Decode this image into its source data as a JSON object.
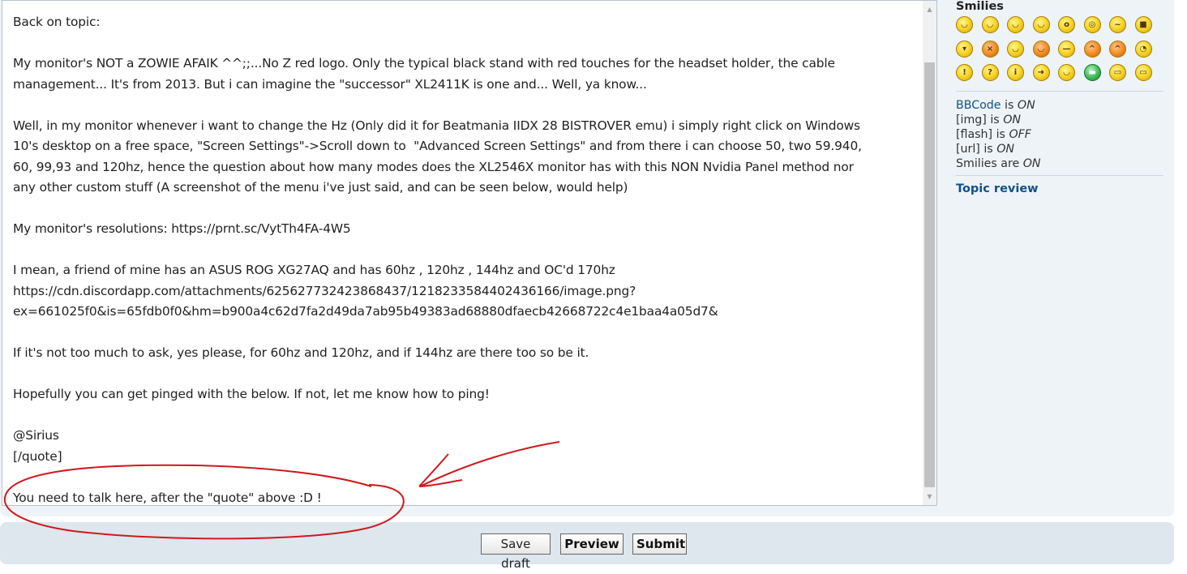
{
  "editor": {
    "lines": [
      "Back on topic:",
      "",
      "My monitor's NOT a ZOWIE AFAIK ^^;;...No Z red logo. Only the typical black stand with red touches for the headset holder, the cable",
      "management... It's from 2013. But i can imagine the \"successor\" XL2411K is one and... Well, ya know...",
      "",
      "Well, in my monitor whenever i want to change the Hz (Only did it for Beatmania IIDX 28 BISTROVER emu) i simply right click on Windows",
      "10's desktop on a free space, \"Screen Settings\"->Scroll down to  \"Advanced Screen Settings\" and from there i can choose 50, two 59.940,",
      "60, 99,93 and 120hz, hence the question about how many modes does the XL2546X monitor has with this NON Nvidia Panel method nor",
      "any other custom stuff (A screenshot of the menu i've just said, and can be seen below, would help)",
      "",
      "My monitor's resolutions: https://prnt.sc/VytTh4FA-4W5",
      "",
      "I mean, a friend of mine has an ASUS ROG XG27AQ and has 60hz , 120hz , 144hz and OC'd 170hz",
      "https://cdn.discordapp.com/attachments/625627732423868437/1218233584402436166/image.png?",
      "ex=661025f0&is=65fdb0f0&hm=b900a4c62d7fa2d49da7ab95b49383ad68880dfaecb42668722c4e1baa4a05d7&",
      "",
      "If it's not too much to ask, yes please, for 60hz and 120hz, and if 144hz are there too so be it.",
      "",
      "Hopefully you can get pinged with the below. If not, let me know how to ping!",
      "",
      "@Sirius",
      "[/quote]",
      "",
      "You need to talk here, after the \"quote\" above :D !"
    ]
  },
  "sidebar": {
    "smilies_title": "Smilies",
    "bbcode_link": "BBCode",
    "bbcode_is": " is ",
    "bbcode_state": "ON",
    "img_label": "[img] is ",
    "img_state": "ON",
    "flash_label": "[flash] is ",
    "flash_state": "OFF",
    "url_label": "[url] is ",
    "url_state": "ON",
    "smilies_label": "Smilies are ",
    "smilies_state": "ON",
    "topic_review": "Topic review"
  },
  "buttons": {
    "save_draft": "Save draft",
    "preview": "Preview",
    "submit": "Submit"
  },
  "colors": {
    "link": "#105289",
    "annotation": "#d0191d"
  },
  "icons": [
    "laugh-smiley-icon",
    "grin-smiley-icon",
    "wink-smiley-icon",
    "razz-smiley-icon",
    "surprised-smiley-icon",
    "eek-smiley-icon",
    "confused-smiley-icon",
    "cool-smiley-icon",
    "lol-smiley-icon",
    "mad-smiley-icon",
    "razz2-smiley-icon",
    "redface-smiley-icon",
    "neutral-smiley-icon",
    "evil-smiley-icon",
    "twisted-smiley-icon",
    "rolleyes-smiley-icon",
    "exclaim-smiley-icon",
    "question-smiley-icon",
    "idea-smiley-icon",
    "arrow-smiley-icon",
    "neutral2-smiley-icon",
    "mrgreen-smiley-icon",
    "geek-smiley-icon",
    "ugeek-smiley-icon"
  ]
}
